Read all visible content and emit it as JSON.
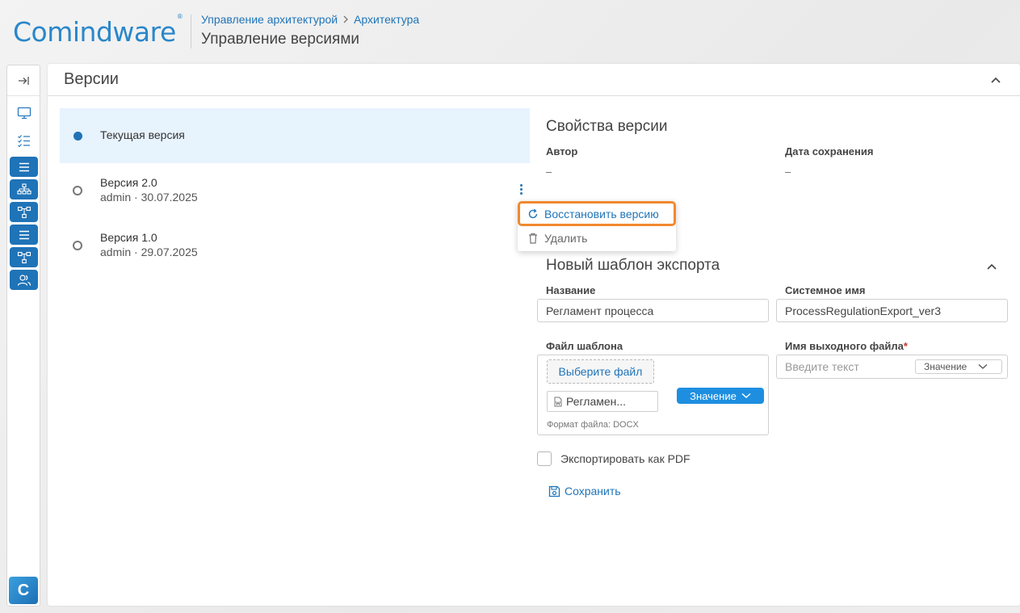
{
  "header": {
    "logo": "Comindware",
    "logo_mark": "®",
    "breadcrumb": [
      "Управление архитектурой",
      "Архитектура"
    ],
    "title": "Управление версиями"
  },
  "sidebar": {
    "expand_icon": "collapse-arrow-icon",
    "items": [
      {
        "icon": "monitor-icon",
        "style": "plain"
      },
      {
        "icon": "checklist-icon",
        "style": "plain"
      },
      {
        "icon": "list-icon",
        "style": "blue"
      },
      {
        "icon": "org-chart-icon",
        "style": "blue"
      },
      {
        "icon": "process-icon",
        "style": "blue"
      },
      {
        "icon": "list-icon",
        "style": "blue"
      },
      {
        "icon": "process-icon",
        "style": "blue"
      },
      {
        "icon": "users-icon",
        "style": "blue"
      }
    ],
    "bottom_logo": "C"
  },
  "panel": {
    "title": "Версии"
  },
  "versions": [
    {
      "name": "Текущая версия",
      "meta": "",
      "selected": true
    },
    {
      "name": "Версия 2.0",
      "meta": "admin · 30.07.2025",
      "selected": false
    },
    {
      "name": "Версия 1.0",
      "meta": "admin · 29.07.2025",
      "selected": false
    }
  ],
  "context_menu": {
    "restore": "Восстановить версию",
    "delete": "Удалить"
  },
  "properties": {
    "title": "Свойства версии",
    "author_label": "Автор",
    "author_value": "–",
    "date_label": "Дата сохранения",
    "date_value": "–"
  },
  "export": {
    "title": "Новый шаблон экспорта",
    "name_label": "Название",
    "name_value": "Регламент процесса",
    "sysname_label": "Системное имя",
    "sysname_value": "ProcessRegulationExport_ver3",
    "file_label": "Файл шаблона",
    "choose_file": "Выберите файл",
    "file_name": "Регламен...",
    "value_button": "Значение",
    "file_format": "Формат файла: DOCX",
    "output_label": "Имя выходного файла",
    "output_required": "*",
    "output_placeholder": "Введите текст",
    "output_value_select": "Значение",
    "pdf_label": "Экспортировать как PDF",
    "save_label": "Сохранить"
  },
  "colors": {
    "accent": "#1f74b8",
    "highlight": "#f0892e",
    "selected_bg": "#e7f3fd"
  }
}
